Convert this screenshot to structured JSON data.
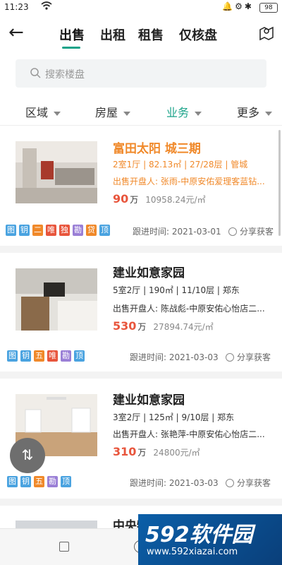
{
  "status": {
    "time": "11:23",
    "battery": "98"
  },
  "nav": {
    "back": "←",
    "tabs": [
      "出售",
      "出租",
      "租售",
      "仅核盘"
    ],
    "active_tab": 0
  },
  "search": {
    "placeholder": "搜索楼盘"
  },
  "filters": [
    {
      "label": "区域"
    },
    {
      "label": "房屋"
    },
    {
      "label": "业务"
    },
    {
      "label": "更多"
    }
  ],
  "listings": [
    {
      "title": "富田太阳 城三期",
      "info": "2室1厅 | 82.13㎡ | 27/28层 | 管城",
      "agent": "出售开盘人: 张雨-中原安佑爱理客蓝钻...",
      "price": "90",
      "unit": "万",
      "unit_price": "10958.24元/㎡",
      "tags": [
        "图",
        "钥",
        "二",
        "唯",
        "独",
        "勘",
        "贷",
        "顶"
      ],
      "follow": "跟进时间: 2021-03-01",
      "share": "分享获客"
    },
    {
      "title": "建业如意家园",
      "info": "5室2厅 | 190㎡ | 11/10层 | 郑东",
      "agent": "出售开盘人: 陈战彪-中原安佑心怡店二...",
      "price": "530",
      "unit": "万",
      "unit_price": "27894.74元/㎡",
      "tags": [
        "图",
        "钥",
        "五",
        "唯",
        "勘",
        "顶"
      ],
      "follow": "跟进时间: 2021-03-03",
      "share": "分享获客"
    },
    {
      "title": "建业如意家园",
      "info": "3室2厅 | 125㎡ | 9/10层 | 郑东",
      "agent": "出售开盘人: 张艳萍-中原安佑心怡店二...",
      "price": "310",
      "unit": "万",
      "unit_price": "24800元/㎡",
      "tags": [
        "图",
        "钥",
        "五",
        "勘",
        "顶"
      ],
      "follow": "跟进时间: 2021-03-03",
      "share": "分享获客"
    },
    {
      "title": "中央特区青春圣地"
    }
  ],
  "float_button": "⇅",
  "watermark": {
    "big": "592软件园",
    "small": "www.592xiazai.com"
  },
  "colors": {
    "accent": "#1aa389",
    "highlight": "#f0892a",
    "price": "#e8553c"
  }
}
